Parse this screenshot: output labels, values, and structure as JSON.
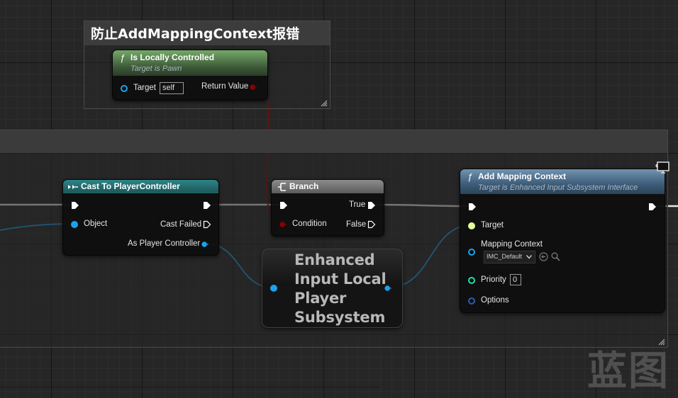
{
  "comment_top": {
    "title": "防止AddMappingContext报错"
  },
  "comment_main": {
    "title": ""
  },
  "nodes": {
    "is_locally_controlled": {
      "func_glyph": "ƒ",
      "title": "Is Locally Controlled",
      "subtitle": "Target is Pawn",
      "target_label": "Target",
      "target_value": "self",
      "return_label": "Return Value"
    },
    "cast": {
      "title": "Cast To PlayerController",
      "object_label": "Object",
      "cast_failed_label": "Cast Failed",
      "as_pc_label": "As Player Controller"
    },
    "branch": {
      "title": "Branch",
      "condition_label": "Condition",
      "true_label": "True",
      "false_label": "False"
    },
    "add_mapping_context": {
      "func_glyph": "ƒ",
      "title": "Add Mapping Context",
      "subtitle": "Target is Enhanced Input Subsystem Interface",
      "target_label": "Target",
      "mapping_context_label": "Mapping Context",
      "mapping_context_value": "IMC_Default",
      "priority_label": "Priority",
      "priority_value": "0",
      "options_label": "Options"
    },
    "subsystem": {
      "line1": "Enhanced",
      "line2": "Input Local",
      "line3": "Player",
      "line4": "Subsystem"
    }
  },
  "watermark": "蓝图",
  "colors": {
    "exec": "#ffffff",
    "object_pin": "#1aa3ec",
    "bool_pin": "#8c0000",
    "struct_pin": "#2a5db0",
    "int_pin": "#1fe0a8",
    "self_pin": "#e4ff9c",
    "local_header": "#5a8c50",
    "cast_header": "#267477",
    "branch_header": "#767676",
    "amc_header": "#557896"
  },
  "icons": [
    "function-icon",
    "cast-icon",
    "branch-icon",
    "exec-pin-icon",
    "data-pin-icon",
    "browse-icon",
    "search-icon",
    "dropdown-arrow-icon",
    "monitor-icon",
    "resize-grip-icon"
  ]
}
